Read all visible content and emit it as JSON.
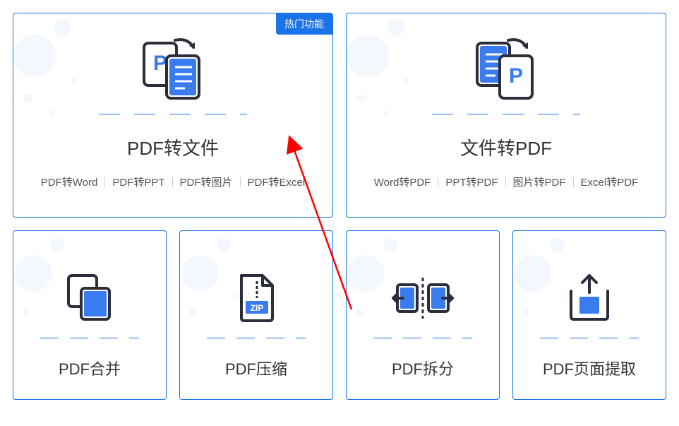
{
  "badge": "热门功能",
  "cards": {
    "pdfToFile": {
      "title": "PDF转文件",
      "subs": [
        "PDF转Word",
        "PDF转PPT",
        "PDF转图片",
        "PDF转Excel"
      ]
    },
    "fileToPdf": {
      "title": "文件转PDF",
      "subs": [
        "Word转PDF",
        "PPT转PDF",
        "图片转PDF",
        "Excel转PDF"
      ]
    },
    "merge": {
      "title": "PDF合并"
    },
    "compress": {
      "title": "PDF压缩"
    },
    "split": {
      "title": "PDF拆分"
    },
    "extract": {
      "title": "PDF页面提取"
    }
  },
  "colors": {
    "primary": "#1a73e8",
    "stroke": "#2a2e3a",
    "light": "#e8f0fe"
  },
  "annotation": {
    "arrow": {
      "color": "#ff0000"
    }
  }
}
